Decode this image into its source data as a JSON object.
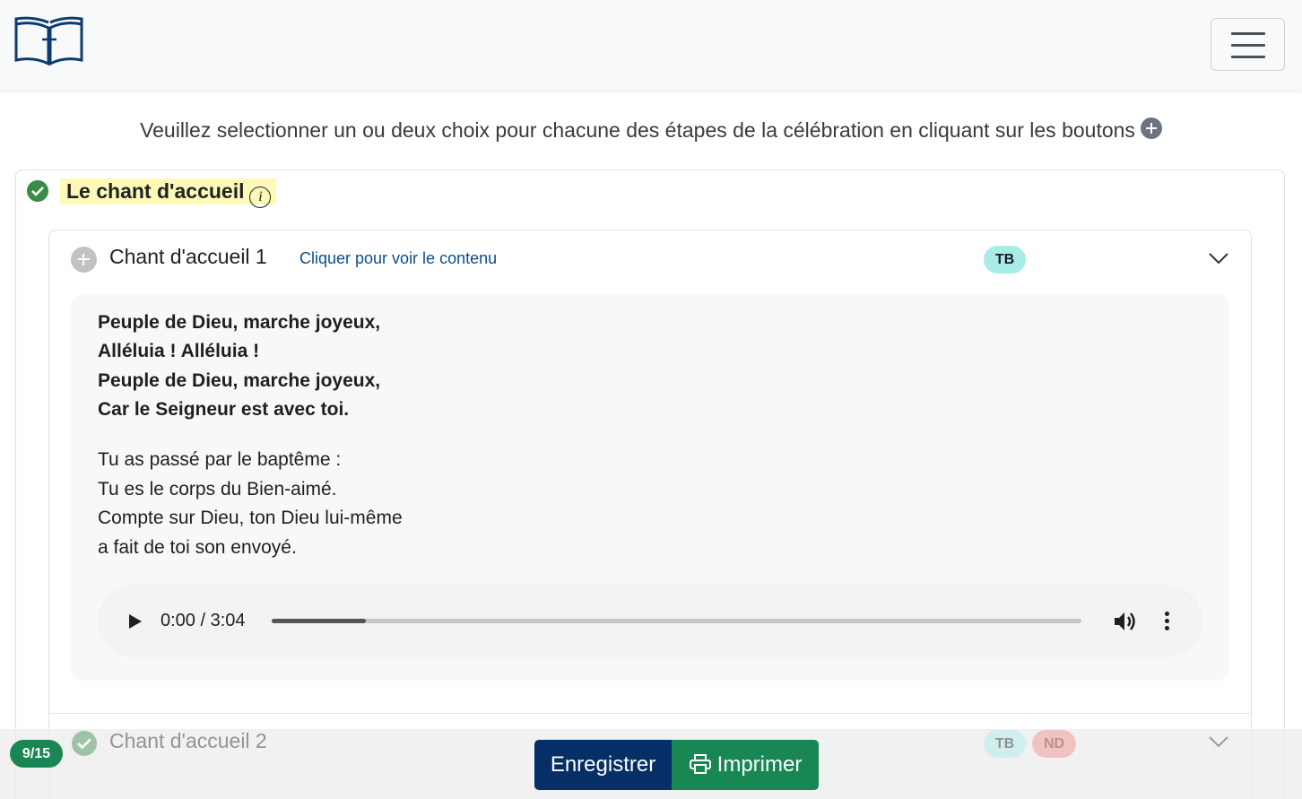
{
  "navbar": {
    "logo_icon": "bible-cross-icon",
    "menu_icon": "hamburger-menu-icon"
  },
  "instruction": {
    "text": "Veuillez selectionner un ou deux choix pour chacune des étapes de la célébration en cliquant sur les boutons",
    "icon": "plus-circle-icon"
  },
  "section": {
    "title": "Le chant d'accueil",
    "status_icon": "check-circle-icon",
    "info_icon": "info-icon",
    "highlight_color": "#fff9b8"
  },
  "item1": {
    "title": "Chant d'accueil 1",
    "link_text": "Cliquer pour voir le contenu",
    "badges": [
      {
        "label": "TB",
        "color": "#a8ece8"
      }
    ],
    "refrain": [
      "Peuple de Dieu, marche joyeux,",
      "Alléluia ! Alléluia !",
      "Peuple de Dieu, marche joyeux,",
      "Car le Seigneur est avec toi."
    ],
    "verse": [
      "Tu as passé par le baptême :",
      "Tu es le corps du Bien-aimé.",
      "Compte sur Dieu, ton Dieu lui-même",
      "a fait de toi son envoyé."
    ],
    "audio": {
      "time": "0:00 / 3:04",
      "buffered_fraction": 0.116
    }
  },
  "item2": {
    "title": "Chant d'accueil 2",
    "badges": [
      {
        "label": "TB",
        "color": "#a8ece8"
      },
      {
        "label": "ND",
        "color": "#f4a6a6"
      }
    ]
  },
  "footer": {
    "counter": "9/15",
    "save_label": "Enregistrer",
    "print_label": "Imprimer",
    "print_icon": "printer-icon"
  },
  "colors": {
    "primary": "#052f66",
    "success": "#198754",
    "link": "#0b4d92"
  }
}
